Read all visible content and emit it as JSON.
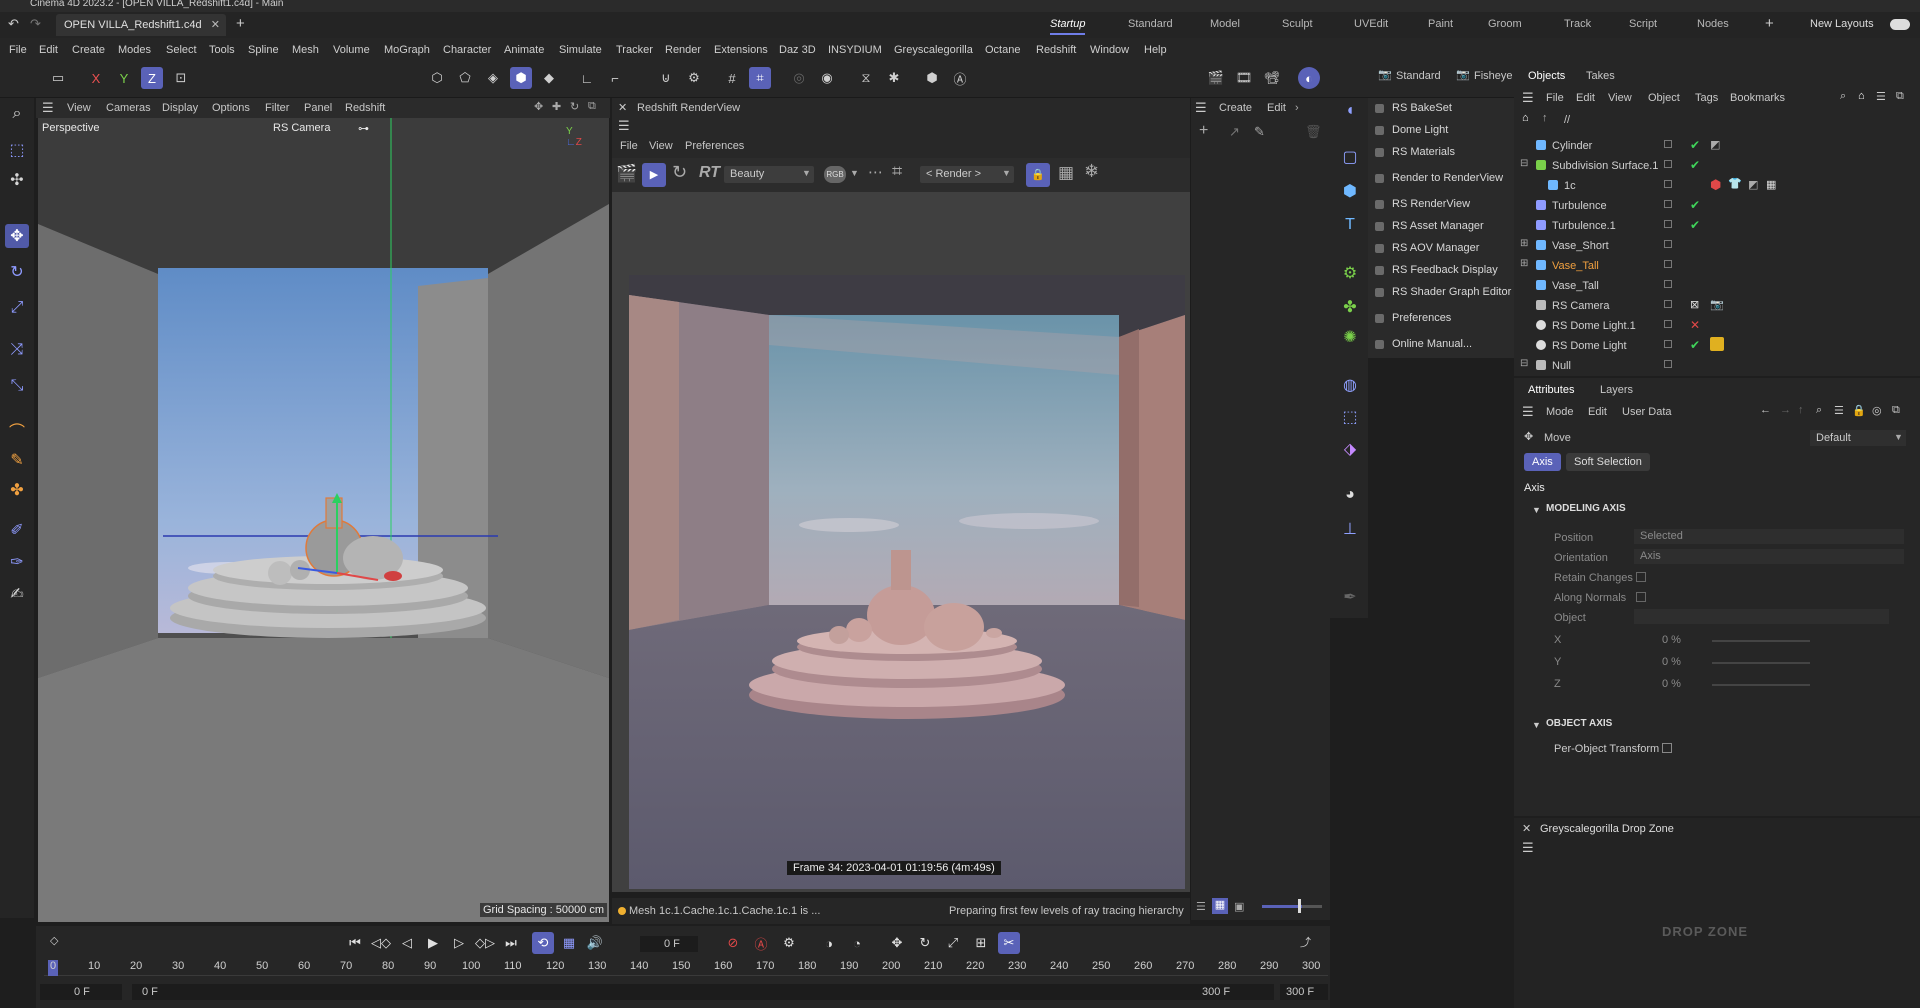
{
  "window": {
    "title": "Cinema 4D 2023.2 - [OPEN VILLA_Redshift1.c4d] - Main"
  },
  "tabs": {
    "document": "OPEN VILLA_Redshift1.c4d"
  },
  "layouts": [
    "Startup",
    "Standard",
    "Model",
    "Sculpt",
    "UVEdit",
    "Paint",
    "Groom",
    "Track",
    "Script",
    "Nodes"
  ],
  "new_layouts": "New Layouts",
  "menu": [
    "File",
    "Edit",
    "Create",
    "Modes",
    "Select",
    "Tools",
    "Spline",
    "Mesh",
    "Volume",
    "MoGraph",
    "Character",
    "Animate",
    "Simulate",
    "Tracker",
    "Render",
    "Extensions",
    "Daz 3D",
    "INSYDIUM",
    "Greyscalegorilla",
    "Octane",
    "Redshift",
    "Window",
    "Help"
  ],
  "viewport": {
    "menu": [
      "View",
      "Cameras",
      "Display",
      "Options",
      "Filter",
      "Panel",
      "Redshift"
    ],
    "projection": "Perspective",
    "camera": "RS Camera",
    "grid_spacing": "Grid Spacing : 50000 cm"
  },
  "renderview": {
    "title": "Redshift RenderView",
    "menu": [
      "File",
      "View",
      "Preferences"
    ],
    "aov": "Beauty",
    "region": "< Render >",
    "frame_info": "Frame  34:  2023-04-01  01:19:56  (4m:49s)",
    "status_mesh": "Mesh 1c.1.Cache.1c.1.Cache.1c.1 is ...",
    "status_right": "Preparing first few levels of ray tracing hierarchy"
  },
  "create_strip": {
    "create": "Create",
    "edit": "Edit"
  },
  "redshift_menu": {
    "tabs": [
      "Standard",
      "Fisheye"
    ],
    "items": [
      "RS BakeSet",
      "Dome Light",
      "RS Materials",
      "Render to RenderView",
      "RS RenderView",
      "RS Asset Manager",
      "RS AOV Manager",
      "RS Feedback Display",
      "RS Shader Graph Editor",
      "Preferences",
      "Online Manual..."
    ]
  },
  "objects": {
    "tabs": [
      "Objects",
      "Takes"
    ],
    "menu": [
      "File",
      "Edit",
      "View",
      "Object",
      "Tags",
      "Bookmarks"
    ],
    "path": "//",
    "rows": [
      {
        "name": "Cylinder",
        "state": "ok"
      },
      {
        "name": "Subdivision Surface.1",
        "state": "ok"
      },
      {
        "name": "1c",
        "state": ""
      },
      {
        "name": "Turbulence",
        "state": "ok"
      },
      {
        "name": "Turbulence.1",
        "state": "ok"
      },
      {
        "name": "Vase_Short",
        "state": ""
      },
      {
        "name": "Vase_Tall",
        "state": "",
        "highlight": true
      },
      {
        "name": "Vase_Tall",
        "state": ""
      },
      {
        "name": "RS Camera",
        "state": ""
      },
      {
        "name": "RS Dome Light.1",
        "state": "bad"
      },
      {
        "name": "RS Dome Light",
        "state": "ok"
      },
      {
        "name": "Null",
        "state": ""
      }
    ]
  },
  "attributes": {
    "tabs": [
      "Attributes",
      "Layers"
    ],
    "menu": [
      "Mode",
      "Edit",
      "User Data"
    ],
    "tool": "Move",
    "preset": "Default",
    "subtabs": [
      "Axis",
      "Soft Selection"
    ],
    "section": "Axis",
    "modeling_axis": {
      "title": "MODELING AXIS",
      "position_label": "Position",
      "position_value": "Selected",
      "orientation_label": "Orientation",
      "orientation_value": "Axis",
      "retain_label": "Retain Changes",
      "along_label": "Along Normals",
      "object_label": "Object",
      "x_label": "X",
      "x_value": "0 %",
      "y_label": "Y",
      "y_value": "0 %",
      "z_label": "Z",
      "z_value": "0 %"
    },
    "object_axis": {
      "title": "OBJECT AXIS",
      "per_object": "Per-Object Transform"
    }
  },
  "dropzone": {
    "title": "Greyscalegorilla Drop Zone",
    "logo": "DROP ZONE"
  },
  "timeline": {
    "current_frame": "0 F",
    "start": "0 F",
    "start2": "0 F",
    "end": "300 F",
    "end2": "300 F",
    "ticks": [
      "0",
      "10",
      "20",
      "30",
      "40",
      "50",
      "60",
      "70",
      "80",
      "90",
      "100",
      "110",
      "120",
      "130",
      "140",
      "150",
      "160",
      "170",
      "180",
      "190",
      "200",
      "210",
      "220",
      "230",
      "240",
      "250",
      "260",
      "270",
      "280",
      "290",
      "300"
    ]
  },
  "colors": {
    "accent": "#5a62b8",
    "ok": "#3fd45a",
    "error": "#e04848",
    "highlight_text": "#f0a040"
  }
}
